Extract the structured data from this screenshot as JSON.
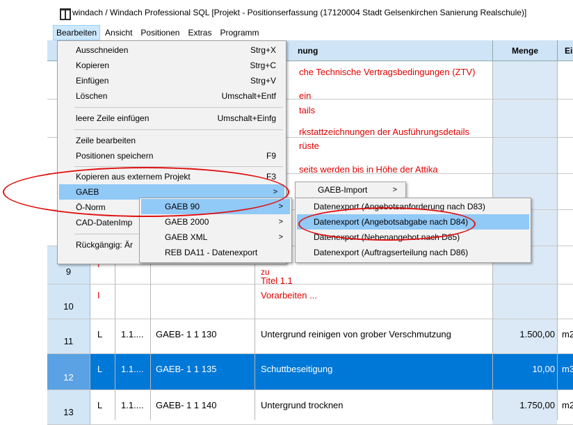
{
  "window": {
    "title": "windach / Windach Professional SQL [Projekt - Positionserfassung (17120004 Stadt Gelsenkirchen Sanierung Realschule)]"
  },
  "menubar": [
    "Bearbeiten",
    "Ansicht",
    "Positionen",
    "Extras",
    "Programm"
  ],
  "grid": {
    "headers": {
      "bezeichnung": "nung",
      "menge": "Menge",
      "einheit": "Ei"
    },
    "background_text": {
      "r1a": "che Technische Vertragsbedingungen (ZTV)",
      "r1b": "ein",
      "r2a": "tails",
      "r2b": "rkstattzeichnungen der Ausführungsdetails",
      "r3a": "rüste",
      "r3b": "seits werden bis in Höhe der Attika"
    },
    "rows": [
      {
        "num": "9",
        "typ": "I",
        "lines": [
          "zu",
          "Titel 1.1"
        ]
      },
      {
        "num": "10",
        "typ": "I",
        "text": "Vorarbeiten ..."
      },
      {
        "num": "11",
        "typ": "L",
        "oz": "1.1....",
        "kurz": "GAEB- 1 1 130",
        "text": "Untergrund reinigen von grober Verschmutzung",
        "menge": "1.500,00",
        "einheit": "m2"
      },
      {
        "num": "12",
        "typ": "L",
        "oz": "1.1....",
        "kurz": "GAEB- 1 1 135",
        "text": "Schuttbeseitigung",
        "menge": "10,00",
        "einheit": "m3"
      },
      {
        "num": "13",
        "typ": "L",
        "oz": "1.1....",
        "kurz": "GAEB- 1 1 140",
        "text": "Untergrund trocknen",
        "menge": "1.750,00",
        "einheit": "m2"
      }
    ]
  },
  "menu_bearbeiten": {
    "items": [
      {
        "label": "Ausschneiden",
        "shortcut": "Strg+X"
      },
      {
        "label": "Kopieren",
        "shortcut": "Strg+C"
      },
      {
        "label": "Einfügen",
        "shortcut": "Strg+V"
      },
      {
        "label": "Löschen",
        "shortcut": "Umschalt+Entf"
      },
      {
        "label": "leere Zeile einfügen",
        "shortcut": "Umschalt+Einfg"
      },
      {
        "label": "Zeile bearbeiten",
        "shortcut": ""
      },
      {
        "label": "Positionen speichern",
        "shortcut": "F9"
      },
      {
        "label": "Kopieren aus externem Projekt",
        "shortcut": "F3"
      },
      {
        "label": "GAEB",
        "shortcut": ""
      },
      {
        "label": "Ö-Norm",
        "shortcut": ""
      },
      {
        "label": "CAD-DatenImp",
        "shortcut": ""
      },
      {
        "label": "Rückgängig: Är",
        "shortcut": ""
      }
    ]
  },
  "menu_gaeb": {
    "items": [
      {
        "label": "GAEB 90"
      },
      {
        "label": "GAEB 2000"
      },
      {
        "label": "GAEB XML"
      },
      {
        "label": "REB DA11 - Datenexport"
      }
    ]
  },
  "menu_gaeb90": {
    "items": [
      {
        "label": "GAEB-Import"
      }
    ]
  },
  "menu_export": {
    "items": [
      {
        "label": "Datenexport (Angebotsanforderung nach D83)"
      },
      {
        "label": "Datenexport (Angebotsabgabe nach D84)"
      },
      {
        "label": "Datenexport (Nebenangebot nach D85)"
      },
      {
        "label": "Datenexport (Auftragserteilung nach D86)"
      }
    ]
  },
  "arrow_glyph": ">",
  "colors": {
    "highlight": "#91c9f7",
    "selection": "#0078d7",
    "annotation": "#e01010",
    "red_text": "#e00000"
  }
}
